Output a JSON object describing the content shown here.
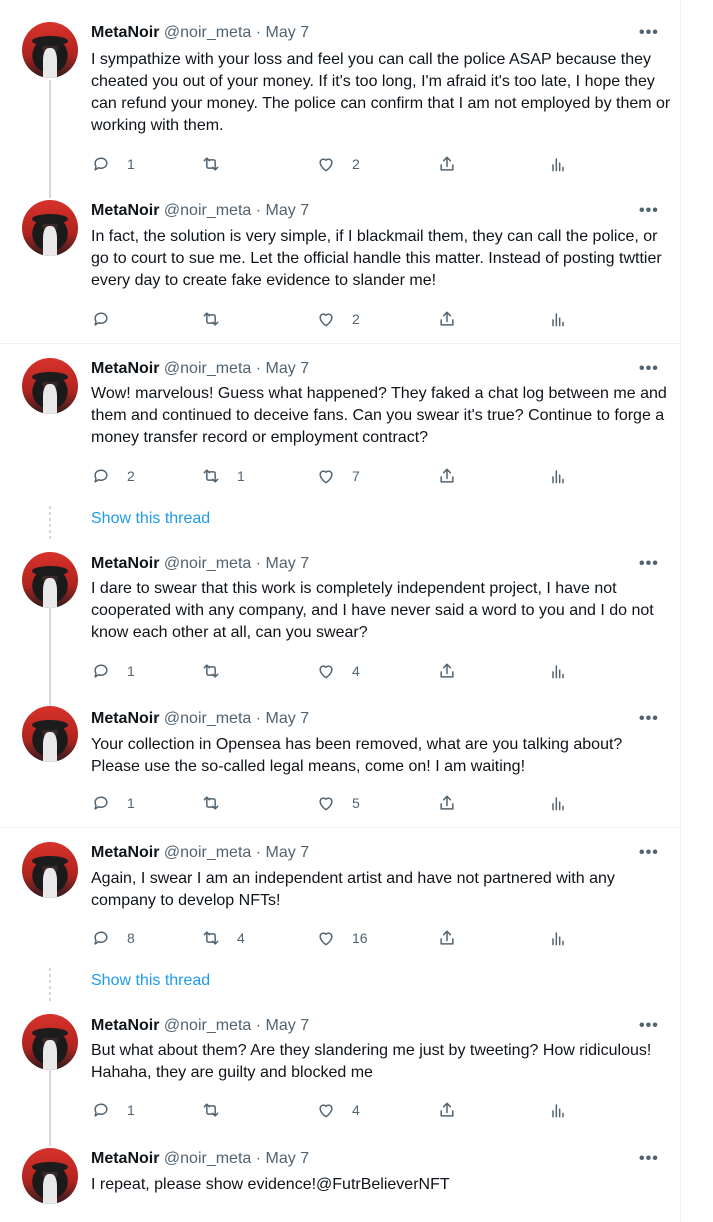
{
  "tweets": [
    {
      "name": "MetaNoir",
      "handle": "@noir_meta",
      "date": "May 7",
      "text": "I sympathize with your loss and feel you can call the police ASAP because they cheated you out of your money. If it's too long, I'm afraid it's too late, I hope they can refund your money. The police can confirm that I am not employed by them or working with them.",
      "replies": "1",
      "retweets": "",
      "likes": "2"
    },
    {
      "name": "MetaNoir",
      "handle": "@noir_meta",
      "date": "May 7",
      "text": "In fact, the solution is very simple, if I blackmail them, they can call the police, or go to court to sue me. Let the official handle this matter. Instead of posting twttier every day to create fake evidence to slander me!",
      "replies": "",
      "retweets": "",
      "likes": "2"
    },
    {
      "name": "MetaNoir",
      "handle": "@noir_meta",
      "date": "May 7",
      "text": "Wow! marvelous! Guess what happened? They faked a chat log between me and them and continued to deceive fans. Can you swear it's true? Continue to forge a money transfer record or employment contract?",
      "replies": "2",
      "retweets": "1",
      "likes": "7"
    },
    {
      "name": "MetaNoir",
      "handle": "@noir_meta",
      "date": "May 7",
      "text": "I dare to swear that this work is completely independent project, I have not cooperated with any company, and I have never said a word to you and I do not know each other at all, can you swear?",
      "replies": "1",
      "retweets": "",
      "likes": "4"
    },
    {
      "name": "MetaNoir",
      "handle": "@noir_meta",
      "date": "May 7",
      "text": "Your collection in Opensea has been removed, what are you talking about? Please use the so-called legal means, come on! I am waiting!",
      "replies": "1",
      "retweets": "",
      "likes": "5"
    },
    {
      "name": "MetaNoir",
      "handle": "@noir_meta",
      "date": "May 7",
      "text": "Again, I swear I am an independent artist and have not partnered with any company to develop NFTs!",
      "replies": "8",
      "retweets": "4",
      "likes": "16"
    },
    {
      "name": "MetaNoir",
      "handle": "@noir_meta",
      "date": "May 7",
      "text": "But what about them? Are they slandering me just by tweeting? How ridiculous! Hahaha, they are guilty and blocked me",
      "replies": "1",
      "retweets": "",
      "likes": "4"
    },
    {
      "name": "MetaNoir",
      "handle": "@noir_meta",
      "date": "May 7",
      "text": "I repeat, please show evidence!@FutrBelieverNFT",
      "replies": "",
      "retweets": "",
      "likes": ""
    }
  ],
  "show_thread_label": "Show this thread",
  "separator": " · ",
  "more_label": "•••"
}
